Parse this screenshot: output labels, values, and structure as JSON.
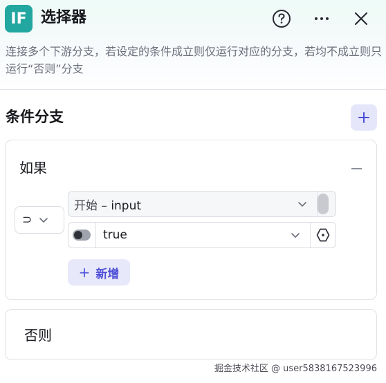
{
  "header": {
    "app_icon_text": "IF",
    "title": "选择器",
    "description": "连接多个下游分支，若设定的条件成立则仅运行对应的分支，若均不成立则只运行“否则”分支",
    "icons": [
      "help-icon",
      "more-icon",
      "close-icon"
    ]
  },
  "branches": {
    "section_title": "条件分支",
    "if_card": {
      "label": "如果",
      "operator_symbol": "⊃",
      "variable_source": "开始",
      "variable_separator": " – ",
      "variable_name": "input",
      "value": "true",
      "add_label": "新增"
    },
    "else_card": {
      "label": "否则"
    }
  },
  "watermark": "掘金技术社区 @ user5838167523996",
  "colors": {
    "accent": "#4d4fd6",
    "app_icon": "#22a6a0",
    "add_bg": "#e8e8fb"
  }
}
